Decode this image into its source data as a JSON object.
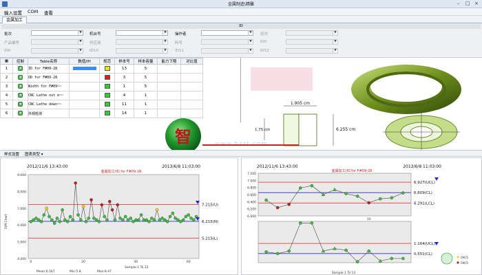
{
  "window": {
    "title": "金属制造\\精雕"
  },
  "menu": {
    "items": [
      "输入设置",
      "COM",
      "查看"
    ]
  },
  "tabs": [
    {
      "label": "金属加工"
    }
  ],
  "form": {
    "id_header": "ID",
    "row1": [
      {
        "label": "批次",
        "enabled": true
      },
      {
        "label": "机台号",
        "enabled": true
      },
      {
        "label": "操作者",
        "enabled": true
      },
      {
        "label": "班次",
        "enabled": false
      }
    ],
    "row2": [
      {
        "label": "产品编号",
        "enabled": false
      },
      {
        "label": "供应商",
        "enabled": false
      },
      {
        "label": "料号",
        "enabled": false
      },
      {
        "label": "ID0",
        "enabled": false
      }
    ],
    "row3": [
      {
        "label": "ID0",
        "enabled": false
      },
      {
        "label": "ID10",
        "enabled": false
      },
      {
        "label": "ID11",
        "enabled": false
      },
      {
        "label": "ID12",
        "enabled": false
      }
    ]
  },
  "table": {
    "headers": [
      "",
      "控制",
      "Table名称",
      "数值/IH",
      "规范",
      "样本号",
      "样本容量",
      "能力下限",
      "对比值"
    ],
    "rows": [
      {
        "num": "1",
        "name": "ID for F#09-28",
        "bar": true,
        "spec_color": "#f2e400",
        "sample_no": "13",
        "sample_size": "5"
      },
      {
        "num": "2",
        "name": "OD for F#09-28",
        "bar": false,
        "spec_color": "#e02020",
        "sample_no": "3",
        "sample_size": "5"
      },
      {
        "num": "3",
        "name": "Width for F#09~~",
        "bar": false,
        "spec_color": "#33cc33",
        "sample_no": "1",
        "sample_size": "5"
      },
      {
        "num": "4",
        "name": "CNC Lathe out e~~",
        "bar": false,
        "spec_color": "#33cc33",
        "sample_no": "4",
        "sample_size": "1"
      },
      {
        "num": "5",
        "name": "CNC Lathe down~~",
        "bar": false,
        "spec_color": "#33cc33",
        "sample_no": "11",
        "sample_size": "1"
      },
      {
        "num": "6",
        "name": "外观检测",
        "bar": false,
        "spec_color": "#33cc33",
        "sample_no": "14",
        "sample_size": "1"
      }
    ]
  },
  "drawing": {
    "dim_top": "1.905 cm",
    "dim_left": "1.75 cm",
    "dim_right": "6.255 cm"
  },
  "watermark": "www.hzzt.com",
  "logo_char": "智",
  "toolbar": {
    "style_label": "样式设置",
    "chart_type_label": "图表类型 ▾"
  },
  "colors": {
    "ucl": "#e04040",
    "center": "#2a2ad0",
    "ok_point": "#3bbf3b",
    "alarm_point": "#c02020",
    "warn_point": "#f0d020"
  },
  "chart_data": [
    {
      "type": "line",
      "date_start": "2012/11/6 13:43:00",
      "date_end": "2013/6/8 11:03:00",
      "subtitle": "金属加工/ID for F#09-28",
      "ylabel": "ISM Chart",
      "ylim": [
        4.0,
        9.0
      ],
      "y_ticks": [
        "9.000",
        "8.000",
        "7.000",
        "6.000",
        "5.000",
        "4.000"
      ],
      "x_ticks": [
        "0",
        "20",
        "40",
        "60"
      ],
      "control_lines": [
        {
          "label": "7.215(U)",
          "value": 7.215
        },
        {
          "label": "6.215(N)",
          "value": 6.215
        },
        {
          "label": "5.215(L)",
          "value": 5.215
        }
      ],
      "footer": [
        "Mean:6.567",
        "Min:5.8",
        "Max:8.47",
        "Sample 1 To 13"
      ],
      "x": [
        0,
        1,
        2,
        3,
        4,
        5,
        6,
        7,
        8,
        9,
        10,
        11,
        12,
        13,
        14,
        15,
        16,
        17,
        18,
        19,
        20,
        21,
        22,
        23,
        24,
        25,
        26,
        27,
        28,
        29,
        30,
        31,
        32,
        33,
        34,
        35,
        36,
        37,
        38,
        39,
        40,
        41,
        42,
        43,
        44,
        45,
        46,
        47,
        48,
        49,
        50,
        51,
        52,
        53,
        54,
        55,
        56,
        57,
        58,
        59,
        60,
        61,
        62,
        63
      ],
      "values": [
        6.2,
        6.3,
        6.4,
        6.3,
        6.2,
        6.6,
        7.0,
        6.5,
        6.3,
        6.1,
        6.4,
        6.2,
        6.9,
        6.3,
        6.2,
        6.5,
        6.3,
        8.5,
        6.6,
        6.3,
        7.1,
        6.2,
        6.4,
        7.5,
        6.4,
        6.3,
        6.2,
        7.2,
        6.5,
        6.3,
        7.4,
        6.9,
        6.3,
        7.2,
        6.4,
        6.3,
        6.5,
        6.3,
        6.4,
        6.2,
        6.3,
        6.3,
        6.6,
        6.3,
        6.3,
        6.2,
        6.4,
        6.3,
        6.9,
        6.3,
        6.4,
        6.3,
        6.2,
        6.5,
        6.7,
        6.4,
        6.3,
        6.2,
        6.3,
        6.5,
        6.6,
        6.4,
        6.3,
        6.5
      ],
      "point_status": [
        "ok",
        "ok",
        "ok",
        "ok",
        "ok",
        "ok",
        "warn",
        "ok",
        "ok",
        "ok",
        "ok",
        "ok",
        "ok",
        "ok",
        "ok",
        "ok",
        "ok",
        "alarm",
        "ok",
        "ok",
        "warn",
        "ok",
        "ok",
        "alarm",
        "ok",
        "ok",
        "ok",
        "alarm",
        "ok",
        "ok",
        "alarm",
        "alarm",
        "ok",
        "alarm",
        "ok",
        "ok",
        "ok",
        "ok",
        "ok",
        "ok",
        "ok",
        "ok",
        "ok",
        "ok",
        "ok",
        "ok",
        "ok",
        "ok",
        "warn",
        "ok",
        "ok",
        "ok",
        "ok",
        "ok",
        "ok",
        "ok",
        "ok",
        "ok",
        "ok",
        "ok",
        "ok",
        "ok",
        "ok",
        "ok"
      ]
    },
    {
      "type": "line",
      "date_start": "2012/11/6 13:43:00",
      "date_end": "2013/6/8 11:03:00",
      "subtitle": "金属加工/ID for F#09-28",
      "ylim": [
        5.9,
        7.2
      ],
      "y_ticks": [
        "7.200",
        "7.000",
        "6.800",
        "6.600",
        "6.400",
        "6.200",
        "6.000"
      ],
      "x_ticks": [
        "10"
      ],
      "control_lines": [
        {
          "label": "6.927(UCL)",
          "value": 6.927
        },
        {
          "label": "6.609(CL)",
          "value": 6.609
        },
        {
          "label": "6.291(LCL)",
          "value": 6.291
        }
      ],
      "x": [
        1,
        2,
        3,
        4,
        5,
        6,
        7,
        8,
        9,
        10,
        11,
        12,
        13
      ],
      "values": [
        6.38,
        6.15,
        6.25,
        6.75,
        6.82,
        6.55,
        6.7,
        6.58,
        6.5,
        6.3,
        6.42,
        6.45,
        6.6
      ],
      "point_status": [
        "ok",
        "alarm",
        "alarm",
        "ok",
        "ok",
        "tri",
        "tri",
        "ok",
        "ok",
        "alarm",
        "ok",
        "ok",
        "ok"
      ]
    },
    {
      "type": "line",
      "subtitle": "",
      "ylim": [
        0,
        2.5
      ],
      "control_lines": [
        {
          "label": "1.164(UCL)",
          "value": 1.164
        },
        {
          "label": "0.551(CL)",
          "value": 0.551
        }
      ],
      "footer": [
        "Sample 1 To 13"
      ],
      "legend": [
        "OK(5",
        "OK(5"
      ],
      "x": [
        1,
        2,
        3,
        4,
        5,
        6,
        7,
        8,
        9,
        10,
        11,
        12,
        13
      ],
      "values": [
        0.65,
        0.55,
        0.7,
        2.4,
        2.4,
        0.7,
        0.85,
        0.75,
        0.05,
        0.7,
        0.1,
        0.25,
        0.25
      ],
      "point_status": [
        "ok",
        "ok",
        "ok",
        "ok",
        "ok",
        "tri",
        "tri",
        "ok",
        "ok",
        "ok",
        "tri",
        "ok",
        "ok"
      ]
    }
  ]
}
